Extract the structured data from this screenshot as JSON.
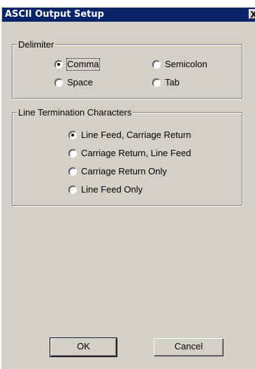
{
  "dialog": {
    "title": "ASCII Output Setup",
    "close_label": "X"
  },
  "delimiter": {
    "legend": "Delimiter",
    "options": [
      {
        "label": "Comma",
        "checked": true
      },
      {
        "label": "Semicolon",
        "checked": false
      },
      {
        "label": "Space",
        "checked": false
      },
      {
        "label": "Tab",
        "checked": false
      }
    ]
  },
  "line_termination": {
    "legend": "Line Termination Characters",
    "options": [
      {
        "label": "Line Feed, Carriage Return",
        "checked": true
      },
      {
        "label": "Carriage Return, Line Feed",
        "checked": false
      },
      {
        "label": "Carriage Return Only",
        "checked": false
      },
      {
        "label": "Line Feed Only",
        "checked": false
      }
    ]
  },
  "buttons": {
    "ok": "OK",
    "cancel": "Cancel"
  }
}
